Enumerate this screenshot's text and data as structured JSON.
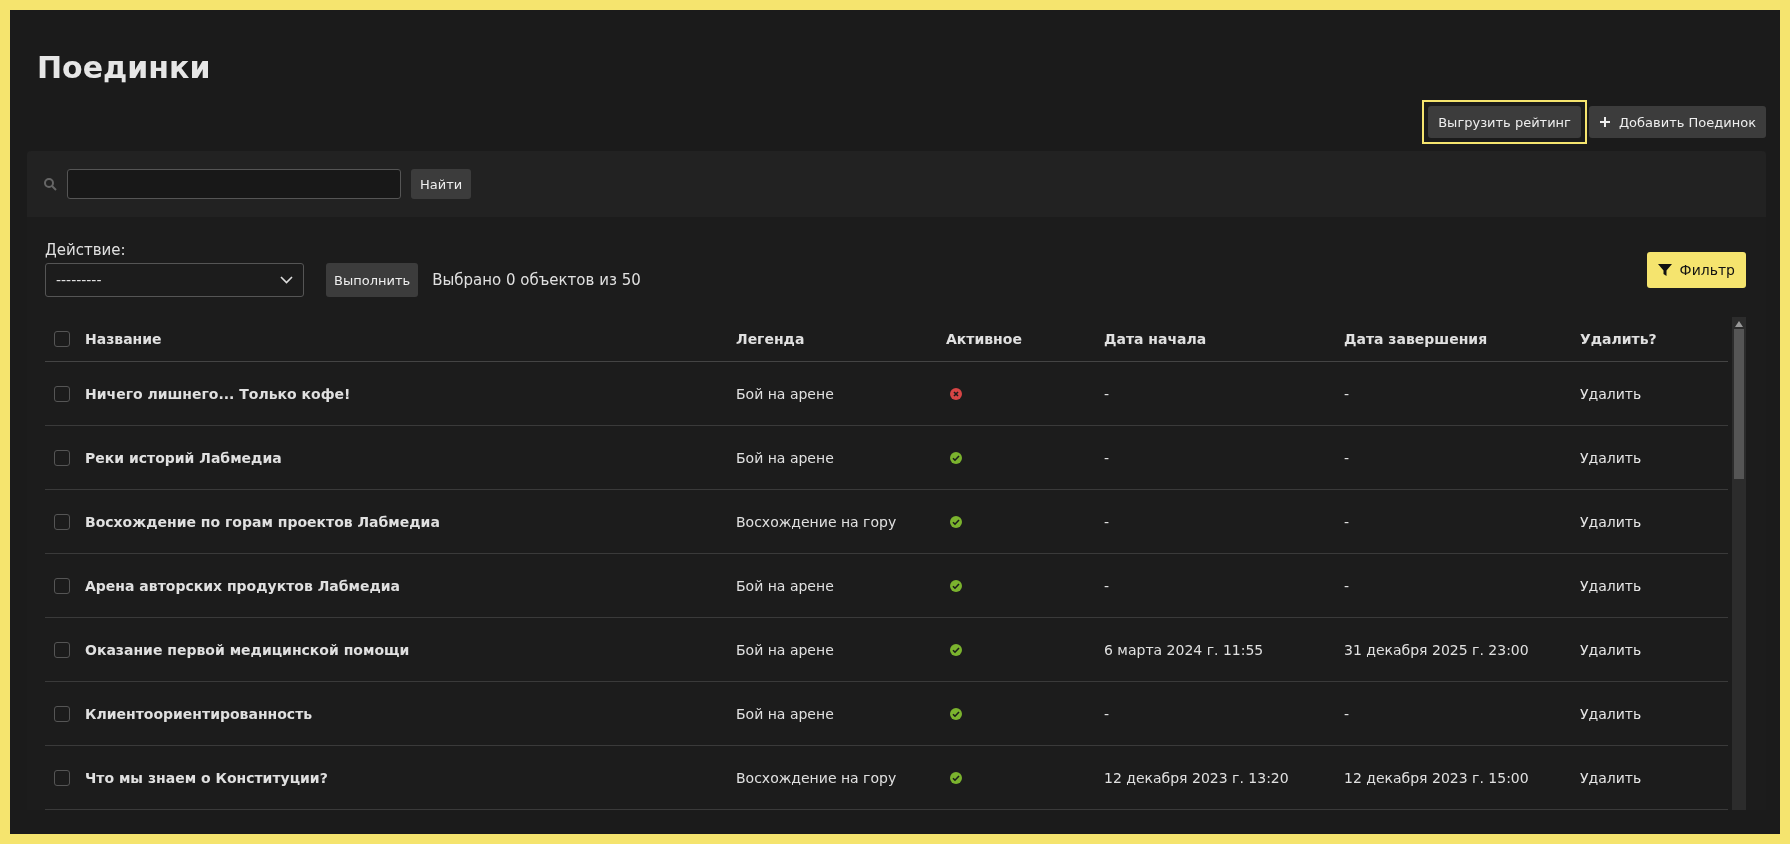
{
  "title": "Поединки",
  "header_buttons": [
    {
      "kind": "plain",
      "label": "Выгрузить рейтинг",
      "highlighted": true
    },
    {
      "kind": "add",
      "label": "Добавить Поединок",
      "highlighted": false
    }
  ],
  "search": {
    "button": "Найти"
  },
  "action": {
    "label": "Действие:",
    "value": "---------",
    "button": "Выполнить",
    "summary": "Выбрано 0 объектов из 50"
  },
  "filter_button": "Фильтр",
  "table": {
    "select_all_checked": false,
    "columns": [
      "Название",
      "Легенда",
      "Активное",
      "Дата начала",
      "Дата завершения",
      "Удалить?"
    ],
    "rows": [
      {
        "checked": false,
        "name": "Ничего лишнего... Только кофе!",
        "legend": "Бой на арене",
        "active": false,
        "start": "-",
        "end": "-",
        "delete": "Удалить"
      },
      {
        "checked": false,
        "name": "Реки историй Лабмедиа",
        "legend": "Бой на арене",
        "active": true,
        "start": "-",
        "end": "-",
        "delete": "Удалить"
      },
      {
        "checked": false,
        "name": "Восхождение по горам проектов Лабмедиа",
        "legend": "Восхождение на гору",
        "active": true,
        "start": "-",
        "end": "-",
        "delete": "Удалить"
      },
      {
        "checked": false,
        "name": "Арена авторских продуктов Лабмедиа",
        "legend": "Бой на арене",
        "active": true,
        "start": "-",
        "end": "-",
        "delete": "Удалить"
      },
      {
        "checked": false,
        "name": "Оказание первой медицинской помощи",
        "legend": "Бой на арене",
        "active": true,
        "start": "6 марта 2024 г. 11:55",
        "end": "31 декабря 2025 г. 23:00",
        "delete": "Удалить"
      },
      {
        "checked": false,
        "name": "Клиентоориентированность",
        "legend": "Бой на арене",
        "active": true,
        "start": "-",
        "end": "-",
        "delete": "Удалить"
      },
      {
        "checked": false,
        "name": "Что мы знаем о Конституции?",
        "legend": "Восхождение на гору",
        "active": true,
        "start": "12 декабря 2023 г. 13:20",
        "end": "12 декабря 2023 г. 15:00",
        "delete": "Удалить"
      }
    ]
  }
}
